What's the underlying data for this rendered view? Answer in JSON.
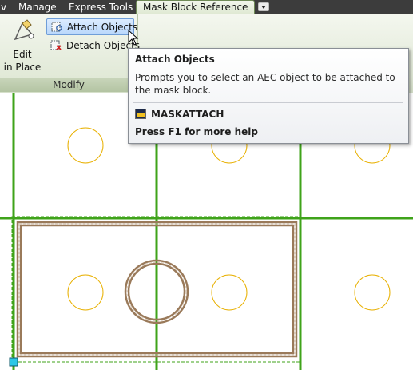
{
  "tabs": {
    "partial_indicator": "v",
    "manage": "Manage",
    "express_tools": "Express Tools",
    "mask_block_reference": "Mask Block Reference"
  },
  "ribbon": {
    "edit_in_place_line1": "Edit",
    "edit_in_place_line2": "in Place",
    "attach_objects": "Attach Objects",
    "detach_objects": "Detach Objects",
    "panel_title": "Modify"
  },
  "tooltip": {
    "title": "Attach Objects",
    "description": "Prompts you to select an AEC object to be attached to the mask block.",
    "command": "MASKATTACH",
    "help": "Press F1 for more help"
  },
  "colors": {
    "grid": "#3fa31a",
    "circle": "#e8b000",
    "mask_outline": "#9a7a5a",
    "grip": "#2cc7e6"
  }
}
